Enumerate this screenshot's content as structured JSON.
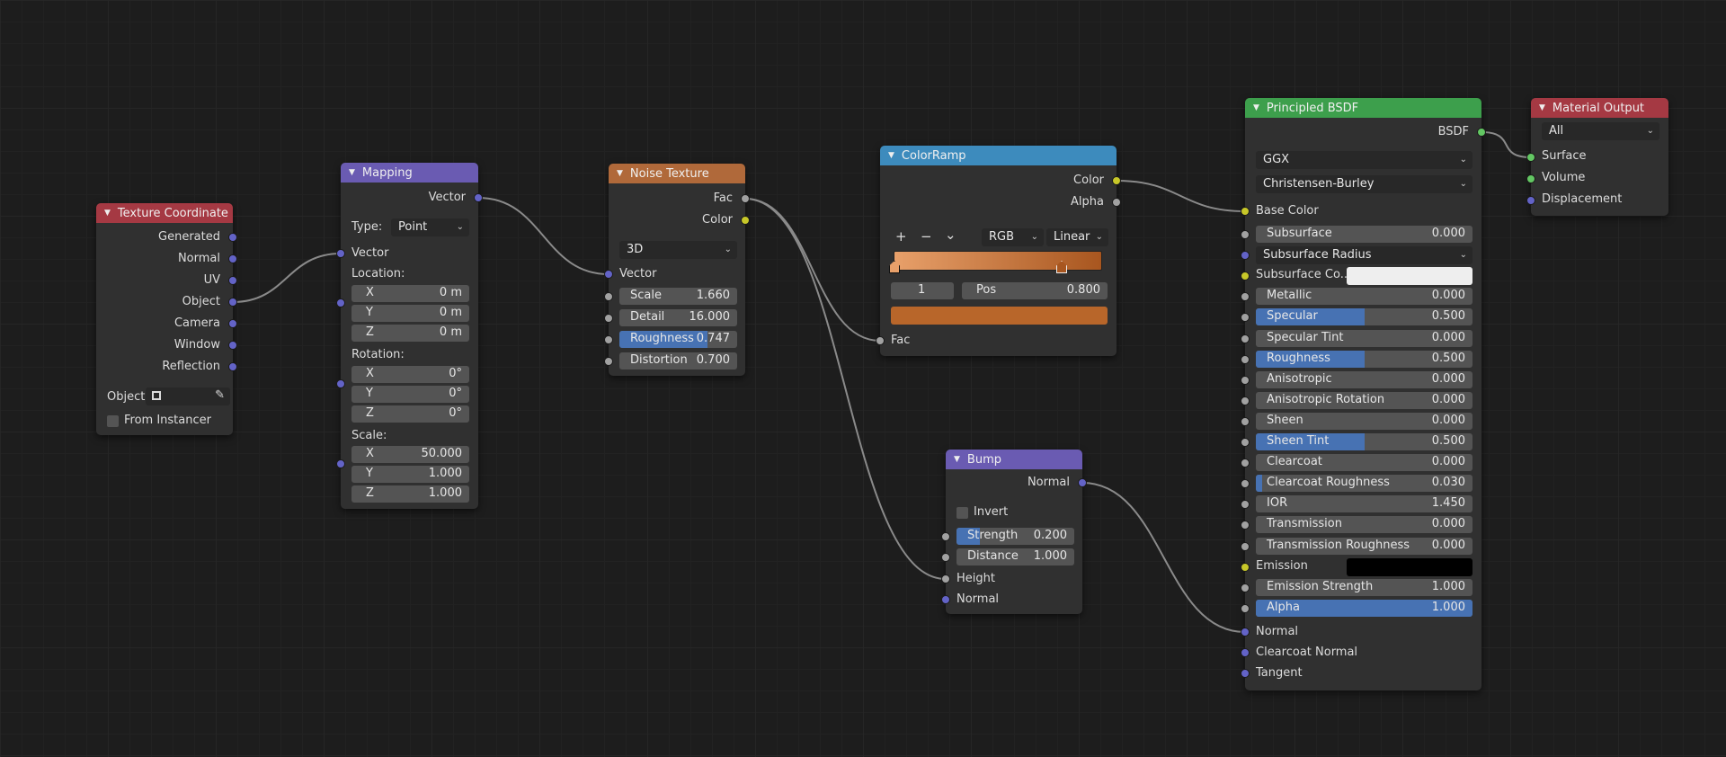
{
  "nodes": {
    "tex_coord": {
      "title": "Texture Coordinate",
      "outputs": [
        "Generated",
        "Normal",
        "UV",
        "Object",
        "Camera",
        "Window",
        "Reflection"
      ],
      "object_label": "Object:",
      "from_instancer": "From Instancer"
    },
    "mapping": {
      "title": "Mapping",
      "output": "Vector",
      "type_label": "Type:",
      "type_value": "Point",
      "input_vector": "Vector",
      "location_label": "Location:",
      "location": [
        {
          "axis": "X",
          "value": "0 m"
        },
        {
          "axis": "Y",
          "value": "0 m"
        },
        {
          "axis": "Z",
          "value": "0 m"
        }
      ],
      "rotation_label": "Rotation:",
      "rotation": [
        {
          "axis": "X",
          "value": "0°"
        },
        {
          "axis": "Y",
          "value": "0°"
        },
        {
          "axis": "Z",
          "value": "0°"
        }
      ],
      "scale_label": "Scale:",
      "scale": [
        {
          "axis": "X",
          "value": "50.000"
        },
        {
          "axis": "Y",
          "value": "1.000"
        },
        {
          "axis": "Z",
          "value": "1.000"
        }
      ]
    },
    "noise": {
      "title": "Noise Texture",
      "outputs": [
        "Fac",
        "Color"
      ],
      "dim": "3D",
      "input_vector": "Vector",
      "fields": [
        {
          "label": "Scale",
          "value": "1.660",
          "fill": 0
        },
        {
          "label": "Detail",
          "value": "16.000",
          "fill": 0
        },
        {
          "label": "Roughness",
          "value": "0.747",
          "fill": 0.747
        },
        {
          "label": "Distortion",
          "value": "0.700",
          "fill": 0
        }
      ]
    },
    "colorramp": {
      "title": "ColorRamp",
      "outputs": [
        "Color",
        "Alpha"
      ],
      "btn_add": "+",
      "btn_remove": "−",
      "btn_menu": "⌄",
      "color_mode": "RGB",
      "interpolation": "Linear",
      "stop_index": "1",
      "pos_label": "Pos",
      "pos_value": "0.800",
      "input": "Fac",
      "stop_color": "#b8662a"
    },
    "bump": {
      "title": "Bump",
      "output": "Normal",
      "invert": "Invert",
      "fields": [
        {
          "label": "Strength",
          "value": "0.200",
          "fill": 0.2
        },
        {
          "label": "Distance",
          "value": "1.000",
          "fill": 0
        }
      ],
      "inputs": [
        "Height",
        "Normal"
      ]
    },
    "bsdf": {
      "title": "Principled BSDF",
      "output": "BSDF",
      "distribution": "GGX",
      "subsurface_method": "Christensen-Burley",
      "base_color": "Base Color",
      "rows": [
        {
          "label": "Subsurface",
          "value": "0.000",
          "fill": 0
        },
        {
          "label": "Subsurface Radius",
          "dropdown": true
        },
        {
          "label": "Subsurface Co...",
          "color": "#eeeeee"
        },
        {
          "label": "Metallic",
          "value": "0.000",
          "fill": 0
        },
        {
          "label": "Specular",
          "value": "0.500",
          "fill": 0.5
        },
        {
          "label": "Specular Tint",
          "value": "0.000",
          "fill": 0
        },
        {
          "label": "Roughness",
          "value": "0.500",
          "fill": 0.5
        },
        {
          "label": "Anisotropic",
          "value": "0.000",
          "fill": 0
        },
        {
          "label": "Anisotropic Rotation",
          "value": "0.000",
          "fill": 0
        },
        {
          "label": "Sheen",
          "value": "0.000",
          "fill": 0
        },
        {
          "label": "Sheen Tint",
          "value": "0.500",
          "fill": 0.5
        },
        {
          "label": "Clearcoat",
          "value": "0.000",
          "fill": 0
        },
        {
          "label": "Clearcoat Roughness",
          "value": "0.030",
          "fill": 0.03
        },
        {
          "label": "IOR",
          "value": "1.450",
          "fill": 0
        },
        {
          "label": "Transmission",
          "value": "0.000",
          "fill": 0
        },
        {
          "label": "Transmission Roughness",
          "value": "0.000",
          "fill": 0
        },
        {
          "label": "Emission",
          "color": "#000000"
        },
        {
          "label": "Emission Strength",
          "value": "1.000",
          "fill": 0
        },
        {
          "label": "Alpha",
          "value": "1.000",
          "fill": 1
        }
      ],
      "bottom_inputs": [
        "Normal",
        "Clearcoat Normal",
        "Tangent"
      ]
    },
    "output": {
      "title": "Material Output",
      "target": "All",
      "inputs": [
        "Surface",
        "Volume",
        "Displacement"
      ]
    }
  },
  "colors": {
    "header_input": "#a53943",
    "header_vector": "#6a5bb2",
    "header_texture": "#b0693a",
    "header_converter": "#3d8bbd",
    "header_shader": "#3d9f4c",
    "header_output": "#a53943",
    "socket_vector": "#6363c7",
    "socket_float": "#a1a1a1",
    "socket_color": "#c7c729",
    "socket_shader": "#63c763",
    "slider_fill": "#4772b3",
    "ramp_start": "#e8a06a",
    "ramp_end": "#a8561f"
  }
}
